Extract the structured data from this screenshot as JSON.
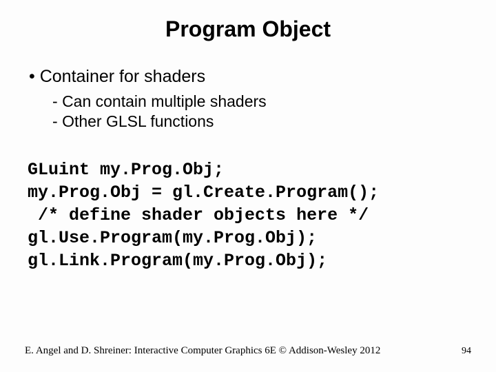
{
  "title": "Program Object",
  "bullets": {
    "b1": "Container for shaders",
    "b2a": "Can contain multiple shaders",
    "b2b": "Other GLSL functions"
  },
  "code": {
    "l1": "GLuint my.Prog.Obj;",
    "l2": "my.Prog.Obj = gl.Create.Program();",
    "l3": " /* define shader objects here */",
    "l4": "gl.Use.Program(my.Prog.Obj);",
    "l5": "gl.Link.Program(my.Prog.Obj);"
  },
  "footer": {
    "attribution": "E. Angel and D. Shreiner: Interactive Computer Graphics 6E © Addison-Wesley 2012",
    "page": "94"
  }
}
